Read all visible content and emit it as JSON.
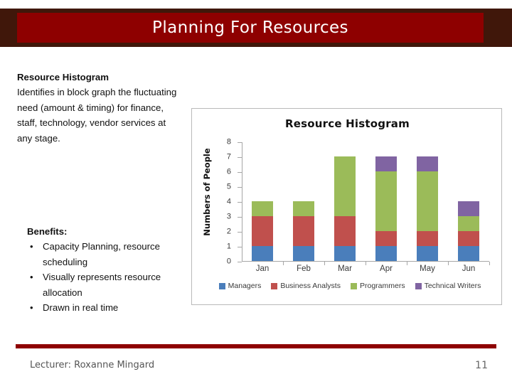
{
  "slide": {
    "title": "Planning For Resources",
    "title_bar_color": "#8e0000",
    "title_bar_border_color": "#40170a"
  },
  "left_column": {
    "heading": "Resource Histogram",
    "paragraph": "Identifies in block graph the fluctuating need (amount & timing) for finance, staff, technology, vendor services at any stage.",
    "benefits_label": "Benefits:",
    "bullet_marker": "•",
    "benefits": [
      "Capacity Planning, resource scheduling",
      "Visually represents resource allocation",
      "Drawn in real time"
    ]
  },
  "chart_data": {
    "type": "bar",
    "stacked": true,
    "title": "Resource Histogram",
    "xlabel": "",
    "ylabel": "Numbers of People",
    "categories": [
      "Jan",
      "Feb",
      "Mar",
      "Apr",
      "May",
      "Jun"
    ],
    "ylim": [
      0,
      8
    ],
    "yticks": [
      0,
      1,
      2,
      3,
      4,
      5,
      6,
      7,
      8
    ],
    "grid": false,
    "legend_position": "bottom",
    "series": [
      {
        "name": "Managers",
        "color": "#4a7ebb",
        "values": [
          1,
          1,
          1,
          1,
          1,
          1
        ]
      },
      {
        "name": "Business Analysts",
        "color": "#c0504d",
        "values": [
          2,
          2,
          2,
          1,
          1,
          1
        ]
      },
      {
        "name": "Programmers",
        "color": "#9bbb59",
        "values": [
          1,
          1,
          4,
          4,
          4,
          1
        ]
      },
      {
        "name": "Technical Writers",
        "color": "#8064a2",
        "values": [
          0,
          0,
          0,
          1,
          1,
          1
        ]
      }
    ],
    "totals": [
      4,
      4,
      7,
      7,
      7,
      4
    ]
  },
  "footer": {
    "lecturer": "Lecturer: Roxanne Mingard",
    "page_number": "11",
    "rule_color": "#8e0000"
  }
}
